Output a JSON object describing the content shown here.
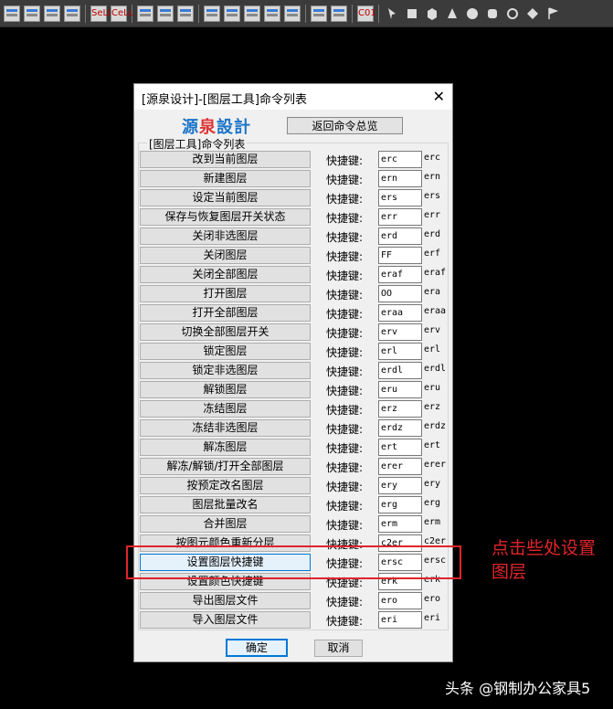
{
  "toolbar": {
    "buttons": [
      {
        "icon": "layer-tool-icon-1"
      },
      {
        "icon": "layer-tool-icon-2"
      },
      {
        "icon": "layer-tool-icon-3"
      },
      {
        "icon": "layer-tool-icon-4"
      },
      {
        "icon": "layer-sell-icon",
        "text": "SeLL"
      },
      {
        "icon": "layer-cell-icon",
        "text": "CeLL"
      },
      {
        "icon": "layer-tool-icon-5"
      },
      {
        "icon": "layer-tool-icon-6"
      },
      {
        "icon": "layer-tool-icon-7"
      },
      {
        "icon": "layer-tool-icon-8"
      },
      {
        "icon": "layer-tool-icon-9"
      },
      {
        "icon": "layer-tool-icon-10"
      },
      {
        "icon": "layer-tool-icon-11"
      },
      {
        "icon": "layer-tool-icon-12"
      },
      {
        "icon": "layer-tool-icon-13"
      },
      {
        "icon": "layer-tool-icon-14"
      },
      {
        "icon": "layer-c01-icon",
        "text": "C01"
      }
    ],
    "shape_icons": [
      "pointer-icon",
      "box-icon",
      "cube-icon",
      "cone-icon",
      "sphere-icon",
      "cylinder-icon",
      "torus-icon",
      "ring-diamond-icon",
      "flag-icon"
    ]
  },
  "dialog": {
    "title": "[源泉设计]-[图层工具]命令列表",
    "close_icon": "close-icon",
    "logo_left": "源",
    "logo_mid": "泉",
    "logo_right": "設計",
    "back_button": "返回命令总览",
    "group_label": "[图层工具]命令列表",
    "shortcut_label": "快捷键:",
    "commands": [
      {
        "name": "改到当前图层",
        "key": "erc",
        "default": "erc"
      },
      {
        "name": "新建图层",
        "key": "ern",
        "default": "ern"
      },
      {
        "name": "设定当前图层",
        "key": "ers",
        "default": "ers"
      },
      {
        "name": "保存与恢复图层开关状态",
        "key": "err",
        "default": "err"
      },
      {
        "name": "关闭非选图层",
        "key": "erd",
        "default": "erd"
      },
      {
        "name": "关闭图层",
        "key": "FF",
        "default": "erf"
      },
      {
        "name": "关闭全部图层",
        "key": "eraf",
        "default": "eraf"
      },
      {
        "name": "打开图层",
        "key": "OO",
        "default": "era"
      },
      {
        "name": "打开全部图层",
        "key": "eraa",
        "default": "eraa"
      },
      {
        "name": "切换全部图层开关",
        "key": "erv",
        "default": "erv"
      },
      {
        "name": "锁定图层",
        "key": "erl",
        "default": "erl"
      },
      {
        "name": "锁定非选图层",
        "key": "erdl",
        "default": "erdl"
      },
      {
        "name": "解锁图层",
        "key": "eru",
        "default": "eru"
      },
      {
        "name": "冻结图层",
        "key": "erz",
        "default": "erz"
      },
      {
        "name": "冻结非选图层",
        "key": "erdz",
        "default": "erdz"
      },
      {
        "name": "解冻图层",
        "key": "ert",
        "default": "ert"
      },
      {
        "name": "解冻/解锁/打开全部图层",
        "key": "erer",
        "default": "erer"
      },
      {
        "name": "按预定改名图层",
        "key": "ery",
        "default": "ery"
      },
      {
        "name": "图层批量改名",
        "key": "erg",
        "default": "erg"
      },
      {
        "name": "合并图层",
        "key": "erm",
        "default": "erm"
      },
      {
        "name": "按图元颜色重新分层",
        "key": "c2er",
        "default": "c2er"
      },
      {
        "name": "设置图层快捷键",
        "key": "ersc",
        "default": "ersc",
        "highlight": true
      },
      {
        "name": "设置颜色快捷键",
        "key": "erk",
        "default": "erk"
      },
      {
        "name": "导出图层文件",
        "key": "ero",
        "default": "ero"
      },
      {
        "name": "导入图层文件",
        "key": "eri",
        "default": "eri"
      }
    ],
    "ok_button": "确定",
    "cancel_button": "取消"
  },
  "annotation": {
    "text": "点击些处设置图层",
    "color": "#e0242b"
  },
  "watermark": "头条 @钢制办公家具5",
  "colors": {
    "accent": "#0078d7",
    "annotation_red": "#e0242b",
    "logo_blue": "#1b74c9",
    "logo_red": "#d33333"
  }
}
